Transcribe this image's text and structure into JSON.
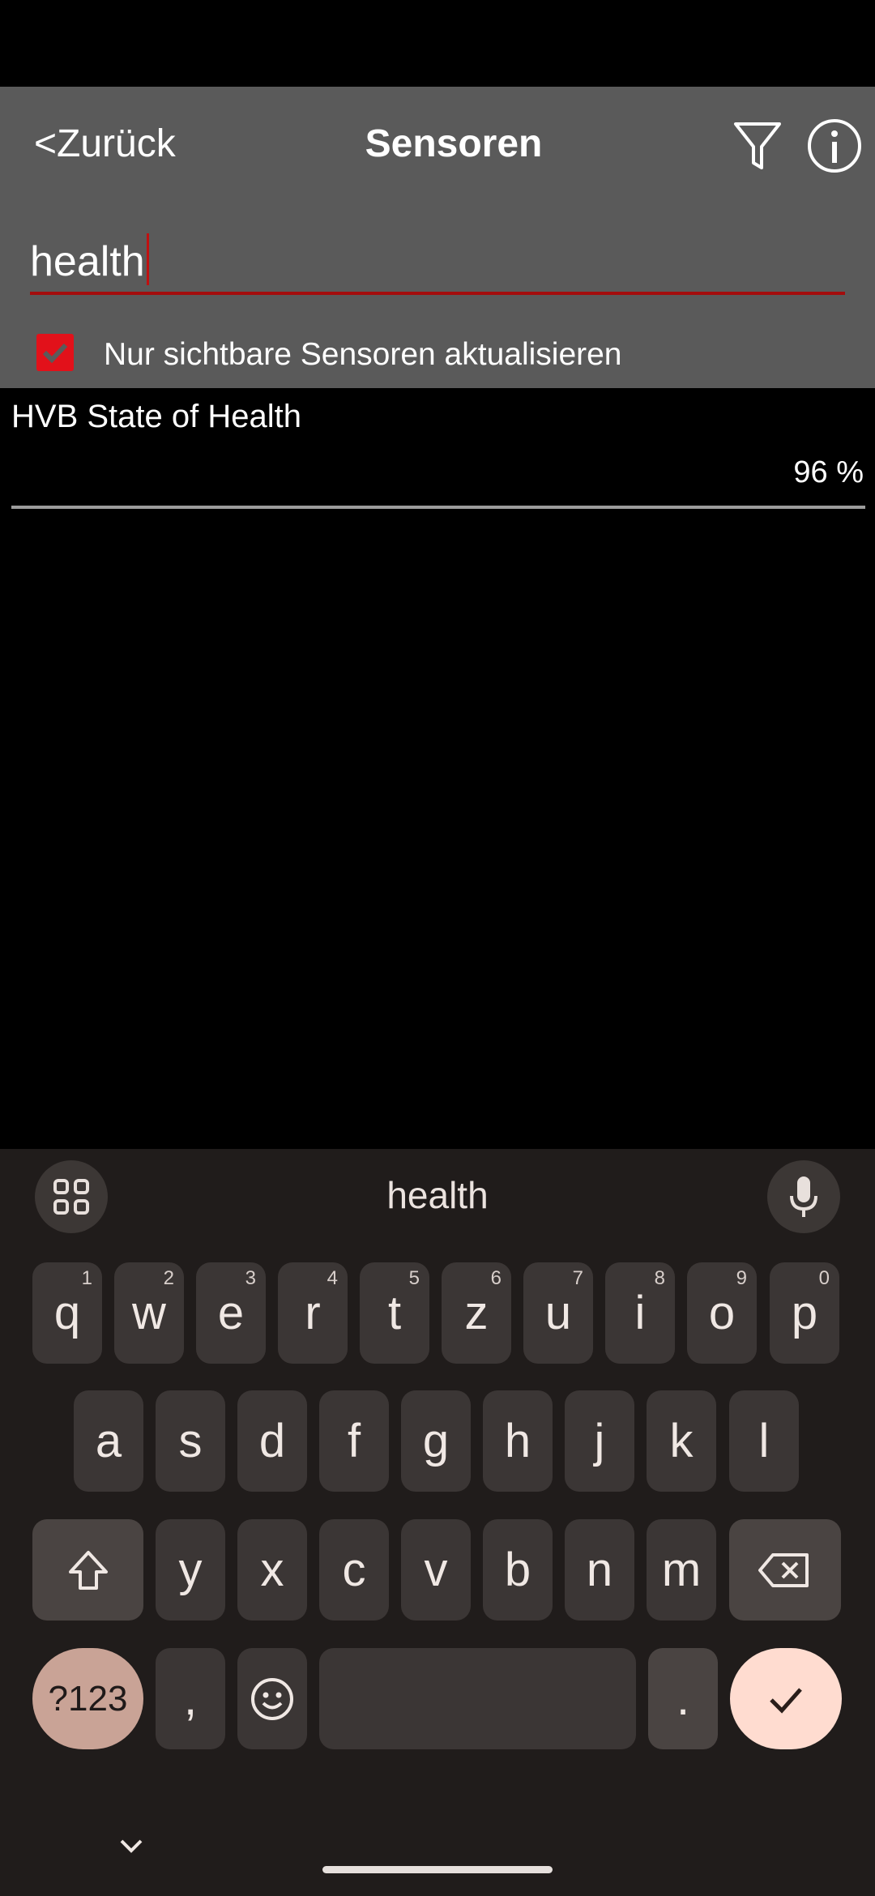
{
  "header": {
    "back_label": "<Zurück",
    "title": "Sensoren"
  },
  "search": {
    "value": "health"
  },
  "option": {
    "label": "Nur sichtbare Sensoren aktualisieren",
    "checked": true
  },
  "sensors": [
    {
      "name": "HVB State of Health",
      "value": "96 %"
    }
  ],
  "keyboard": {
    "suggestion": "health",
    "row1": [
      {
        "k": "q",
        "h": "1"
      },
      {
        "k": "w",
        "h": "2"
      },
      {
        "k": "e",
        "h": "3"
      },
      {
        "k": "r",
        "h": "4"
      },
      {
        "k": "t",
        "h": "5"
      },
      {
        "k": "z",
        "h": "6"
      },
      {
        "k": "u",
        "h": "7"
      },
      {
        "k": "i",
        "h": "8"
      },
      {
        "k": "o",
        "h": "9"
      },
      {
        "k": "p",
        "h": "0"
      }
    ],
    "row2": [
      "a",
      "s",
      "d",
      "f",
      "g",
      "h",
      "j",
      "k",
      "l"
    ],
    "row3": [
      "y",
      "x",
      "c",
      "v",
      "b",
      "n",
      "m"
    ],
    "symbols_label": "?123",
    "comma": ",",
    "period": "."
  },
  "colors": {
    "accent": "#e2111a",
    "appbar": "#5a5a5a",
    "keyboard_bg": "#201c1b"
  },
  "icons": [
    "filter-icon",
    "info-icon",
    "apps-grid-icon",
    "microphone-icon",
    "shift-icon",
    "backspace-icon",
    "emoji-icon",
    "check-icon",
    "chevron-down-icon"
  ]
}
